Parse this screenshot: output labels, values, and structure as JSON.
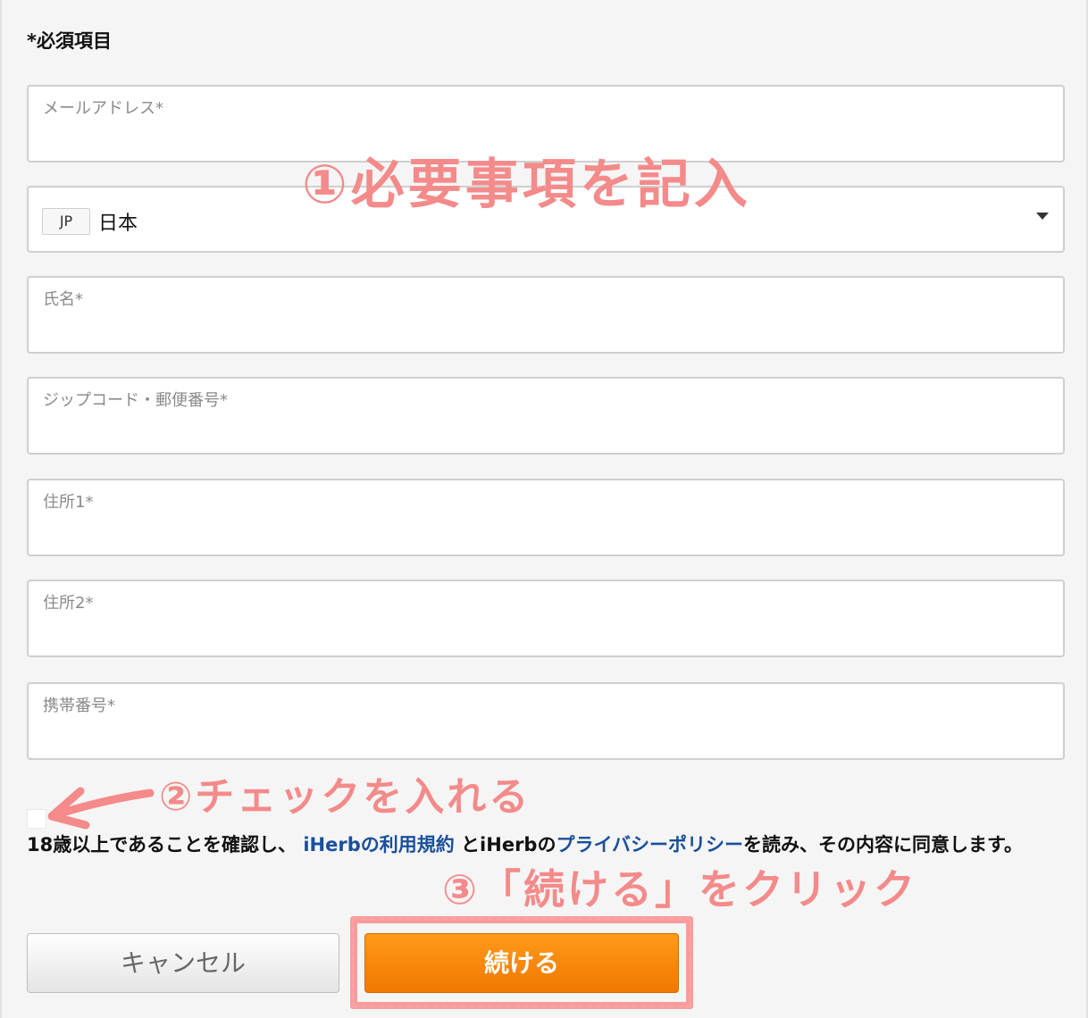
{
  "form": {
    "required_note": "*必須項目",
    "fields": [
      {
        "label": "メールアドレス*"
      },
      {
        "label": "氏名*"
      },
      {
        "label": "ジップコード・郵便番号*"
      },
      {
        "label": "住所1*"
      },
      {
        "label": "住所2*"
      },
      {
        "label": "携帯番号*"
      }
    ],
    "country": {
      "code": "JP",
      "name": "日本"
    },
    "consent": {
      "prefix": "18歳以上であることを確認し、",
      "terms_link": "iHerbの利用規約",
      "middle": "とiHerbの",
      "privacy_link": "プライバシーポリシー",
      "suffix": "を読み、その内容に同意します。"
    },
    "buttons": {
      "cancel": "キャンセル",
      "continue": "続ける"
    }
  },
  "annotations": {
    "step1": "①必要事項を記入",
    "step2": "②チェックを入れる",
    "step3": "③「続ける」をクリック",
    "color": "#f48a8a"
  },
  "colors": {
    "accent_orange": "#f58400",
    "link_blue": "#1a4f9c"
  }
}
